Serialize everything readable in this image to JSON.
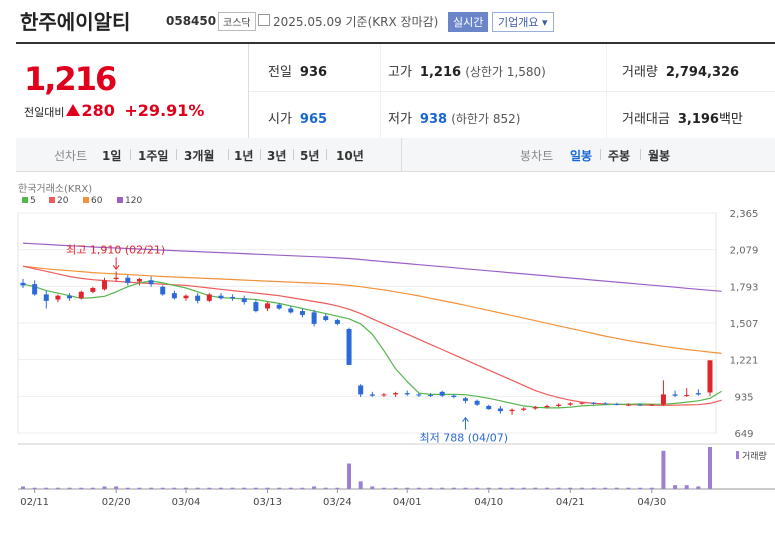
{
  "header": {
    "name": "한주에이알티",
    "code": "058450",
    "market": "코스닥",
    "date": "2025.05.09 기준(KRX 장마감)",
    "realtime": "실시간",
    "company": "기업개요"
  },
  "quote": {
    "price": "1,216",
    "change_label": "전일대비",
    "change": "280",
    "change_pct": "+29.91%",
    "prev_label": "전일",
    "prev": "936",
    "high_label": "고가",
    "high": "1,216",
    "upper_limit": "(상한가 1,580)",
    "volume_label": "거래량",
    "volume": "2,794,326",
    "open_label": "시가",
    "open": "965",
    "low_label": "저가",
    "low": "938",
    "lower_limit": "(하한가 852)",
    "amount_label": "거래대금",
    "amount": "3,196",
    "amount_unit": "백만"
  },
  "periods": {
    "line_label": "선차트",
    "items": [
      "1일",
      "1주일",
      "3개월",
      "1년",
      "3년",
      "5년",
      "10년"
    ],
    "candle_label": "봉차트",
    "candle_items": [
      "일봉",
      "주봉",
      "월봉"
    ],
    "candle_selected": "일봉"
  },
  "chart_data": {
    "type": "candlestick",
    "source": "한국거래소(KRX)",
    "legend": [
      {
        "name": "5",
        "color": "#55b64b"
      },
      {
        "name": "20",
        "color": "#ee5b5b"
      },
      {
        "name": "60",
        "color": "#f3923a"
      },
      {
        "name": "120",
        "color": "#9b61c9"
      }
    ],
    "y_ticks": [
      2365,
      2079,
      1793,
      1507,
      1221,
      935,
      649
    ],
    "ylim": [
      649,
      2365
    ],
    "x_ticks": [
      "02/11",
      "02/20",
      "03/04",
      "03/13",
      "03/24",
      "04/01",
      "04/10",
      "04/21",
      "04/30"
    ],
    "x_tick_index": [
      1,
      8,
      14,
      21,
      27,
      33,
      40,
      47,
      54
    ],
    "candles": [
      {
        "o": 1820,
        "h": 1850,
        "l": 1780,
        "c": 1800
      },
      {
        "o": 1810,
        "h": 1840,
        "l": 1720,
        "c": 1730
      },
      {
        "o": 1730,
        "h": 1760,
        "l": 1620,
        "c": 1680
      },
      {
        "o": 1690,
        "h": 1730,
        "l": 1670,
        "c": 1720
      },
      {
        "o": 1720,
        "h": 1740,
        "l": 1680,
        "c": 1700
      },
      {
        "o": 1700,
        "h": 1760,
        "l": 1690,
        "c": 1750
      },
      {
        "o": 1750,
        "h": 1790,
        "l": 1740,
        "c": 1780
      },
      {
        "o": 1770,
        "h": 1860,
        "l": 1760,
        "c": 1840
      },
      {
        "o": 1850,
        "h": 1910,
        "l": 1830,
        "c": 1860
      },
      {
        "o": 1860,
        "h": 1880,
        "l": 1800,
        "c": 1820
      },
      {
        "o": 1830,
        "h": 1860,
        "l": 1800,
        "c": 1850
      },
      {
        "o": 1840,
        "h": 1870,
        "l": 1790,
        "c": 1810
      },
      {
        "o": 1790,
        "h": 1800,
        "l": 1720,
        "c": 1730
      },
      {
        "o": 1740,
        "h": 1760,
        "l": 1690,
        "c": 1700
      },
      {
        "o": 1700,
        "h": 1730,
        "l": 1680,
        "c": 1720
      },
      {
        "o": 1720,
        "h": 1740,
        "l": 1660,
        "c": 1680
      },
      {
        "o": 1680,
        "h": 1740,
        "l": 1670,
        "c": 1730
      },
      {
        "o": 1720,
        "h": 1740,
        "l": 1690,
        "c": 1700
      },
      {
        "o": 1710,
        "h": 1730,
        "l": 1680,
        "c": 1700
      },
      {
        "o": 1700,
        "h": 1720,
        "l": 1650,
        "c": 1670
      },
      {
        "o": 1670,
        "h": 1690,
        "l": 1590,
        "c": 1600
      },
      {
        "o": 1620,
        "h": 1670,
        "l": 1600,
        "c": 1660
      },
      {
        "o": 1650,
        "h": 1660,
        "l": 1610,
        "c": 1620
      },
      {
        "o": 1620,
        "h": 1640,
        "l": 1580,
        "c": 1590
      },
      {
        "o": 1600,
        "h": 1620,
        "l": 1550,
        "c": 1570
      },
      {
        "o": 1590,
        "h": 1610,
        "l": 1480,
        "c": 1500
      },
      {
        "o": 1560,
        "h": 1580,
        "l": 1520,
        "c": 1530
      },
      {
        "o": 1530,
        "h": 1540,
        "l": 1490,
        "c": 1500
      },
      {
        "o": 1460,
        "h": 1470,
        "l": 1180,
        "c": 1180
      },
      {
        "o": 1020,
        "h": 1030,
        "l": 930,
        "c": 950
      },
      {
        "o": 950,
        "h": 970,
        "l": 930,
        "c": 940
      },
      {
        "o": 950,
        "h": 960,
        "l": 930,
        "c": 950
      },
      {
        "o": 950,
        "h": 970,
        "l": 930,
        "c": 960
      },
      {
        "o": 960,
        "h": 980,
        "l": 940,
        "c": 950
      },
      {
        "o": 950,
        "h": 960,
        "l": 930,
        "c": 945
      },
      {
        "o": 945,
        "h": 960,
        "l": 930,
        "c": 940
      },
      {
        "o": 970,
        "h": 980,
        "l": 930,
        "c": 940
      },
      {
        "o": 940,
        "h": 950,
        "l": 920,
        "c": 930
      },
      {
        "o": 920,
        "h": 930,
        "l": 880,
        "c": 900
      },
      {
        "o": 900,
        "h": 910,
        "l": 860,
        "c": 870
      },
      {
        "o": 860,
        "h": 870,
        "l": 830,
        "c": 835
      },
      {
        "o": 840,
        "h": 860,
        "l": 800,
        "c": 820
      },
      {
        "o": 820,
        "h": 840,
        "l": 790,
        "c": 830
      },
      {
        "o": 830,
        "h": 850,
        "l": 820,
        "c": 840
      },
      {
        "o": 840,
        "h": 860,
        "l": 830,
        "c": 850
      },
      {
        "o": 850,
        "h": 870,
        "l": 840,
        "c": 860
      },
      {
        "o": 860,
        "h": 880,
        "l": 850,
        "c": 870
      },
      {
        "o": 870,
        "h": 890,
        "l": 860,
        "c": 880
      },
      {
        "o": 880,
        "h": 890,
        "l": 870,
        "c": 885
      },
      {
        "o": 885,
        "h": 890,
        "l": 870,
        "c": 880
      },
      {
        "o": 880,
        "h": 890,
        "l": 870,
        "c": 875
      },
      {
        "o": 875,
        "h": 885,
        "l": 865,
        "c": 870
      },
      {
        "o": 870,
        "h": 880,
        "l": 860,
        "c": 870
      },
      {
        "o": 870,
        "h": 880,
        "l": 860,
        "c": 865
      },
      {
        "o": 865,
        "h": 875,
        "l": 860,
        "c": 870
      },
      {
        "o": 870,
        "h": 1060,
        "l": 860,
        "c": 950
      },
      {
        "o": 950,
        "h": 980,
        "l": 930,
        "c": 940
      },
      {
        "o": 940,
        "h": 1000,
        "l": 930,
        "c": 945
      },
      {
        "o": 960,
        "h": 990,
        "l": 940,
        "c": 950
      },
      {
        "o": 965,
        "h": 1216,
        "l": 938,
        "c": 1216
      }
    ],
    "ma5": [
      1810,
      1790,
      1760,
      1740,
      1720,
      1700,
      1705,
      1715,
      1750,
      1790,
      1820,
      1835,
      1820,
      1800,
      1780,
      1750,
      1720,
      1705,
      1700,
      1695,
      1690,
      1675,
      1660,
      1640,
      1620,
      1600,
      1580,
      1560,
      1540,
      1500,
      1420,
      1290,
      1150,
      1050,
      960,
      950,
      950,
      950,
      948,
      935,
      920,
      900,
      880,
      860,
      850,
      845,
      845,
      850,
      860,
      865,
      870,
      872,
      874,
      875,
      874,
      873,
      880,
      890,
      900,
      920,
      975
    ],
    "ma20": [
      1950,
      1930,
      1910,
      1890,
      1870,
      1855,
      1845,
      1838,
      1832,
      1826,
      1820,
      1815,
      1810,
      1805,
      1800,
      1790,
      1780,
      1770,
      1760,
      1750,
      1740,
      1730,
      1720,
      1705,
      1690,
      1675,
      1660,
      1640,
      1615,
      1580,
      1540,
      1500,
      1460,
      1420,
      1380,
      1340,
      1300,
      1260,
      1220,
      1180,
      1140,
      1100,
      1060,
      1020,
      980,
      950,
      925,
      905,
      890,
      880,
      875,
      872,
      870,
      868,
      866,
      865,
      866,
      868,
      870,
      880,
      905
    ],
    "ma60": [
      1950,
      1940,
      1930,
      1922,
      1915,
      1908,
      1900,
      1895,
      1890,
      1885,
      1880,
      1875,
      1870,
      1866,
      1862,
      1858,
      1854,
      1850,
      1846,
      1842,
      1838,
      1834,
      1830,
      1826,
      1822,
      1818,
      1814,
      1808,
      1800,
      1790,
      1778,
      1765,
      1750,
      1735,
      1718,
      1700,
      1682,
      1664,
      1645,
      1625,
      1605,
      1585,
      1565,
      1545,
      1525,
      1505,
      1485,
      1465,
      1445,
      1425,
      1405,
      1388,
      1370,
      1355,
      1340,
      1325,
      1312,
      1300,
      1290,
      1280,
      1270
    ],
    "ma120": [
      2130,
      2125,
      2120,
      2115,
      2110,
      2105,
      2100,
      2096,
      2092,
      2088,
      2084,
      2080,
      2076,
      2072,
      2068,
      2064,
      2060,
      2056,
      2052,
      2048,
      2044,
      2040,
      2036,
      2032,
      2028,
      2024,
      2020,
      2015,
      2010,
      2002,
      1994,
      1986,
      1978,
      1970,
      1962,
      1954,
      1946,
      1938,
      1930,
      1922,
      1914,
      1906,
      1898,
      1890,
      1882,
      1874,
      1866,
      1858,
      1850,
      1842,
      1834,
      1826,
      1818,
      1810,
      1802,
      1794,
      1786,
      1778,
      1770,
      1762,
      1754
    ],
    "volumes": [
      2,
      1,
      1,
      1,
      1,
      1,
      1,
      2,
      2,
      1,
      1,
      1,
      1,
      1,
      1,
      1,
      1,
      1,
      1,
      1,
      1,
      1,
      1,
      1,
      1,
      2,
      1,
      1,
      20,
      6,
      2,
      1,
      1,
      1,
      1,
      1,
      1,
      1,
      1,
      1,
      1,
      1,
      1,
      1,
      1,
      1,
      1,
      1,
      1,
      1,
      1,
      1,
      1,
      1,
      1,
      30,
      3,
      3,
      2,
      33
    ],
    "annotations": {
      "high": {
        "text": "최고 1,910 (02/21)",
        "index": 8
      },
      "low": {
        "text": "최저 788 (04/07)",
        "index": 41
      }
    },
    "volume_label": "거래량"
  }
}
